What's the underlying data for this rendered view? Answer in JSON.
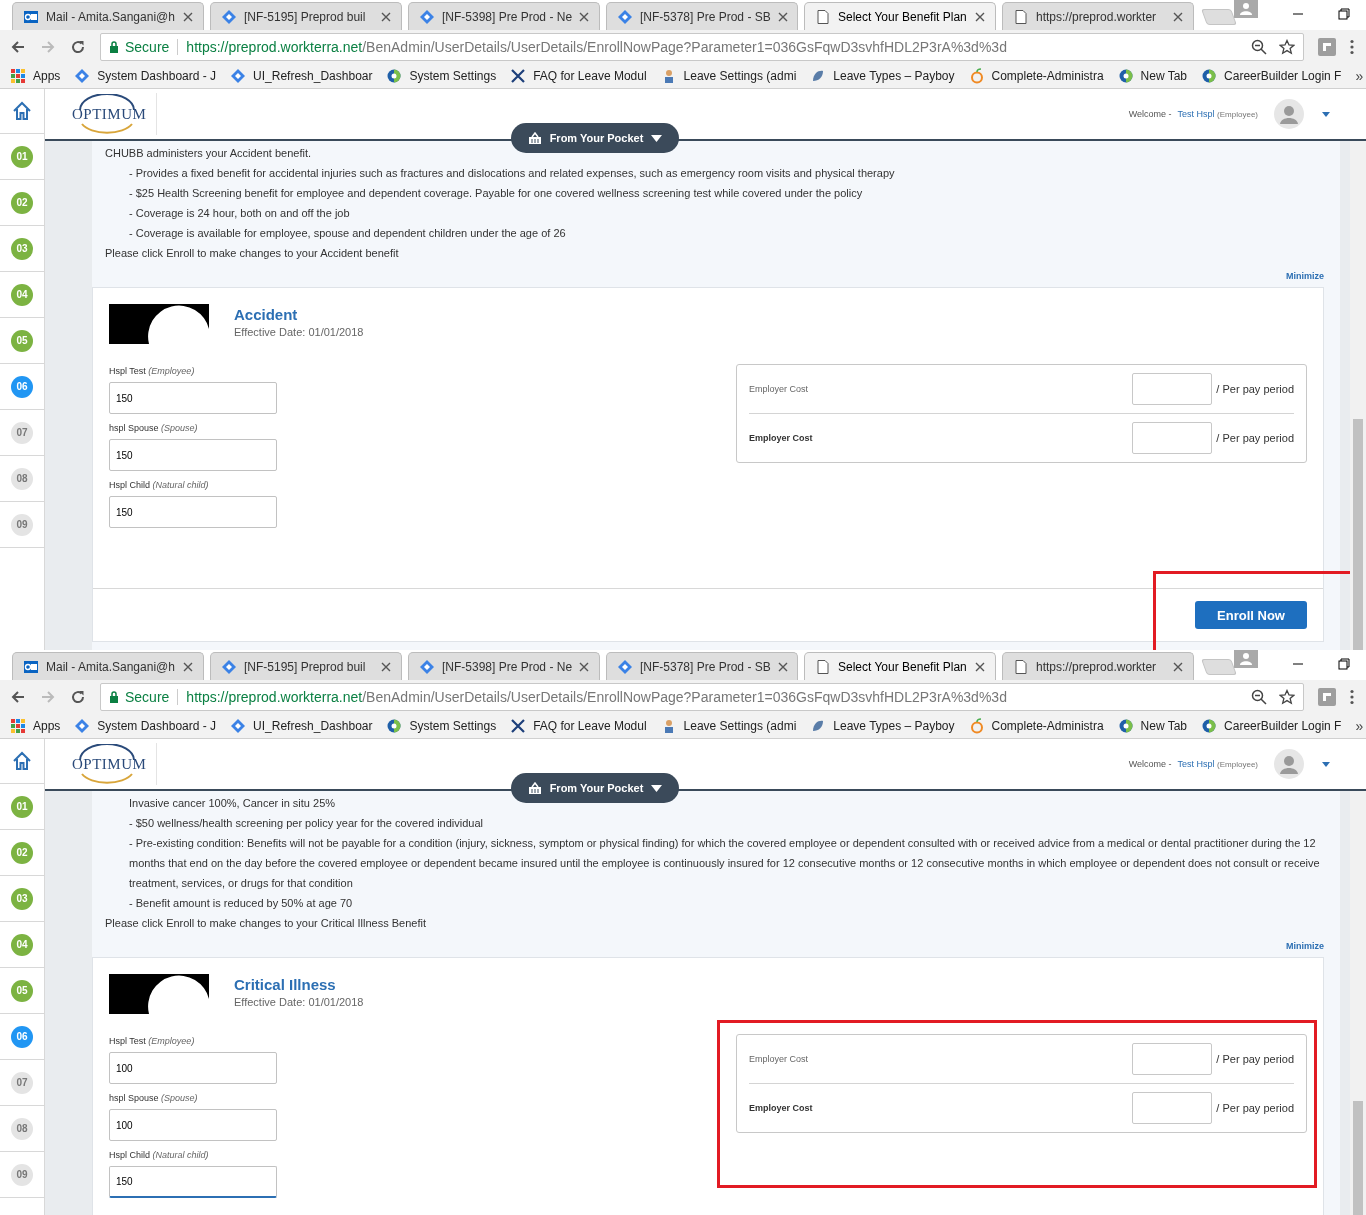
{
  "captures": [
    {
      "tabs": [
        {
          "label": "Mail - Amita.Sangani@h",
          "kind": "mail",
          "selected": false
        },
        {
          "label": "[NF-5195] Preprod buil",
          "kind": "diamond",
          "selected": false
        },
        {
          "label": "[NF-5398] Pre Prod - Ne",
          "kind": "diamond",
          "selected": false
        },
        {
          "label": "[NF-5378] Pre Prod - SB",
          "kind": "diamond",
          "selected": false
        },
        {
          "label": "Select Your Benefit Plan",
          "kind": "page",
          "selected": true
        },
        {
          "label": "https://preprod.workter",
          "kind": "page",
          "selected": false
        }
      ],
      "address": {
        "secure_label": "Secure",
        "host": "https://preprod.workterra.net",
        "path": "/BenAdmin/UserDetails/UserDetails/EnrollNowPage?Parameter1=036GsFqwD3svhfHDL2P3rA%3d%3d"
      },
      "bookmarks": [
        {
          "label": "Apps",
          "kind": "apps"
        },
        {
          "label": "System Dashboard - J",
          "kind": "diamond"
        },
        {
          "label": "UI_Refresh_Dashboar",
          "kind": "diamond"
        },
        {
          "label": "System Settings",
          "kind": "globe"
        },
        {
          "label": "FAQ for Leave Modul",
          "kind": "tools"
        },
        {
          "label": "Leave Settings (admi",
          "kind": "figure"
        },
        {
          "label": "Leave Types – Payboy",
          "kind": "leaf"
        },
        {
          "label": "Complete-Administra",
          "kind": "fruit"
        },
        {
          "label": "New Tab",
          "kind": "globe"
        },
        {
          "label": "CareerBuilder Login F",
          "kind": "globe"
        }
      ],
      "bookmarks_more": "»",
      "header": {
        "logo": "OPTIMUM",
        "welcome": "Welcome -",
        "user": "Test Hspl",
        "role": "(Employee)"
      },
      "pocket_button": "From Your Pocket",
      "steps": [
        {
          "label": "01",
          "completed": true,
          "selected": false
        },
        {
          "label": "02",
          "completed": true,
          "selected": false
        },
        {
          "label": "03",
          "completed": true,
          "selected": false
        },
        {
          "label": "04",
          "completed": true,
          "selected": false
        },
        {
          "label": "05",
          "completed": true,
          "selected": false
        },
        {
          "label": "06",
          "completed": false,
          "selected": true
        },
        {
          "label": "07",
          "completed": false,
          "selected": false
        },
        {
          "label": "08",
          "completed": false,
          "selected": false
        },
        {
          "label": "09",
          "completed": false,
          "selected": false
        }
      ],
      "description": [
        {
          "kind": "line",
          "text": "CHUBB administers your Accident benefit."
        },
        {
          "kind": "bullet",
          "text": "- Provides a fixed benefit for accidental injuries such as fractures and dislocations and related expenses, such as emergency room visits and physical therapy"
        },
        {
          "kind": "bullet",
          "text": "- $25 Health Screening benefit for employee and dependent coverage.  Payable for one covered wellness screening test while covered under the policy"
        },
        {
          "kind": "bullet",
          "text": "- Coverage is 24 hour, both on and off the job"
        },
        {
          "kind": "bullet",
          "text": "- Coverage is available for employee, spouse and dependent children under the age of 26"
        },
        {
          "kind": "line",
          "text": "Please click Enroll to make changes to your Accident benefit"
        }
      ],
      "minimize": "Minimize",
      "plan": {
        "name": "Accident",
        "effective_date": "Effective Date: 01/01/2018",
        "members": [
          {
            "name": "Hspl Test",
            "relation": "(Employee)",
            "value": "150",
            "focused": false
          },
          {
            "name": "hspl Spouse",
            "relation": "(Spouse)",
            "value": "150",
            "focused": false
          },
          {
            "name": "Hspl Child",
            "relation": "(Natural child)",
            "value": "150",
            "focused": false
          }
        ],
        "costs": [
          {
            "label": "Employer Cost",
            "unit": "/ Per pay period",
            "emphasis": false
          },
          {
            "label": "Employer Cost",
            "unit": "/ Per pay period",
            "emphasis": true
          }
        ],
        "enroll_button": {
          "label": "Enroll Now",
          "highlighted": true
        }
      }
    },
    {
      "tabs": [
        {
          "label": "Mail - Amita.Sangani@h",
          "kind": "mail",
          "selected": false
        },
        {
          "label": "[NF-5195] Preprod buil",
          "kind": "diamond",
          "selected": false
        },
        {
          "label": "[NF-5398] Pre Prod - Ne",
          "kind": "diamond",
          "selected": false
        },
        {
          "label": "[NF-5378] Pre Prod - SB",
          "kind": "diamond",
          "selected": false
        },
        {
          "label": "Select Your Benefit Plan",
          "kind": "page",
          "selected": true
        },
        {
          "label": "https://preprod.workter",
          "kind": "page",
          "selected": false
        }
      ],
      "address": {
        "secure_label": "Secure",
        "host": "https://preprod.workterra.net",
        "path": "/BenAdmin/UserDetails/UserDetails/EnrollNowPage?Parameter1=036GsFqwD3svhfHDL2P3rA%3d%3d"
      },
      "bookmarks": [
        {
          "label": "Apps",
          "kind": "apps"
        },
        {
          "label": "System Dashboard - J",
          "kind": "diamond"
        },
        {
          "label": "UI_Refresh_Dashboar",
          "kind": "diamond"
        },
        {
          "label": "System Settings",
          "kind": "globe"
        },
        {
          "label": "FAQ for Leave Modul",
          "kind": "tools"
        },
        {
          "label": "Leave Settings (admi",
          "kind": "figure"
        },
        {
          "label": "Leave Types – Payboy",
          "kind": "leaf"
        },
        {
          "label": "Complete-Administra",
          "kind": "fruit"
        },
        {
          "label": "New Tab",
          "kind": "globe"
        },
        {
          "label": "CareerBuilder Login F",
          "kind": "globe"
        }
      ],
      "bookmarks_more": "»",
      "header": {
        "logo": "OPTIMUM",
        "welcome": "Welcome -",
        "user": "Test Hspl",
        "role": "(Employee)"
      },
      "pocket_button": "From Your Pocket",
      "steps": [
        {
          "label": "01",
          "completed": true,
          "selected": false
        },
        {
          "label": "02",
          "completed": true,
          "selected": false
        },
        {
          "label": "03",
          "completed": true,
          "selected": false
        },
        {
          "label": "04",
          "completed": true,
          "selected": false
        },
        {
          "label": "05",
          "completed": true,
          "selected": false
        },
        {
          "label": "06",
          "completed": false,
          "selected": true
        },
        {
          "label": "07",
          "completed": false,
          "selected": false
        },
        {
          "label": "08",
          "completed": false,
          "selected": false
        },
        {
          "label": "09",
          "completed": false,
          "selected": false
        }
      ],
      "description": [
        {
          "kind": "bullet",
          "text": "Invasive cancer 100%, Cancer in situ 25%"
        },
        {
          "kind": "bullet",
          "text": "- $50 wellness/health screening per policy year for the covered individual"
        },
        {
          "kind": "bullet",
          "text": "- Pre-existing condition: Benefits will not be payable for a condition (injury, sickness, symptom or physical finding) for which the covered employee or dependent consulted with or received advice from a medical or dental practitioner during the 12 months that end on the day before the covered employee or dependent became insured until the employee is continuously insured for 12 consecutive months or 12 consecutive months in which employee or dependent does not consult or receive treatment, services, or drugs for that condition"
        },
        {
          "kind": "bullet",
          "text": "- Benefit amount is reduced by 50% at age 70"
        },
        {
          "kind": "line",
          "text": "Please click Enroll to make changes to your Critical Illness Benefit"
        }
      ],
      "minimize": "Minimize",
      "plan": {
        "name": "Critical Illness",
        "effective_date": "Effective Date: 01/01/2018",
        "members": [
          {
            "name": "Hspl Test",
            "relation": "(Employee)",
            "value": "100",
            "focused": false
          },
          {
            "name": "hspl Spouse",
            "relation": "(Spouse)",
            "value": "100",
            "focused": false
          },
          {
            "name": "Hspl Child",
            "relation": "(Natural child)",
            "value": "150",
            "focused": true
          }
        ],
        "costs": [
          {
            "label": "Employer Cost",
            "unit": "/ Per pay period",
            "emphasis": false
          },
          {
            "label": "Employer Cost",
            "unit": "/ Per pay period",
            "emphasis": true
          }
        ],
        "costs_highlighted": true
      }
    }
  ]
}
